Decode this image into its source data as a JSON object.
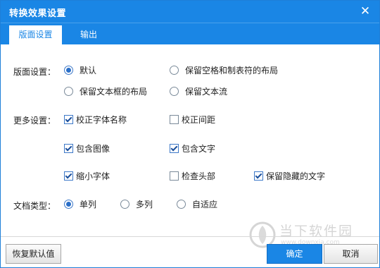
{
  "window": {
    "title": "转换效果设置",
    "close_glyph": "✕"
  },
  "tabs": [
    {
      "label": "版面设置",
      "active": true
    },
    {
      "label": "输出",
      "active": false
    }
  ],
  "layout_settings": {
    "label": "版面设置：",
    "options": [
      {
        "label": "默认",
        "selected": true
      },
      {
        "label": "保留空格和制表符的布局",
        "selected": false
      },
      {
        "label": "保留文本框的布局",
        "selected": false
      },
      {
        "label": "保留文本流",
        "selected": false
      }
    ]
  },
  "more_settings": {
    "label": "更多设置：",
    "options": [
      {
        "label": "校正字体名称",
        "checked": true
      },
      {
        "label": "校正间距",
        "checked": false
      },
      {
        "label": "包含图像",
        "checked": true
      },
      {
        "label": "包含文字",
        "checked": true
      },
      {
        "label": "缩小字体",
        "checked": true
      },
      {
        "label": "检查头部",
        "checked": false
      },
      {
        "label": "保留隐藏的文字",
        "checked": true
      }
    ]
  },
  "doc_type": {
    "label": "文档类型：",
    "options": [
      {
        "label": "单列",
        "selected": true
      },
      {
        "label": "多列",
        "selected": false
      },
      {
        "label": "自适应",
        "selected": false
      }
    ]
  },
  "buttons": {
    "restore": "恢复默认值",
    "ok": "确定",
    "cancel": "取消"
  },
  "watermark": {
    "text": "当下软件园",
    "url": "www.downxia.com"
  },
  "colors": {
    "accent": "#1a86e5",
    "border": "#1e7fd8"
  }
}
